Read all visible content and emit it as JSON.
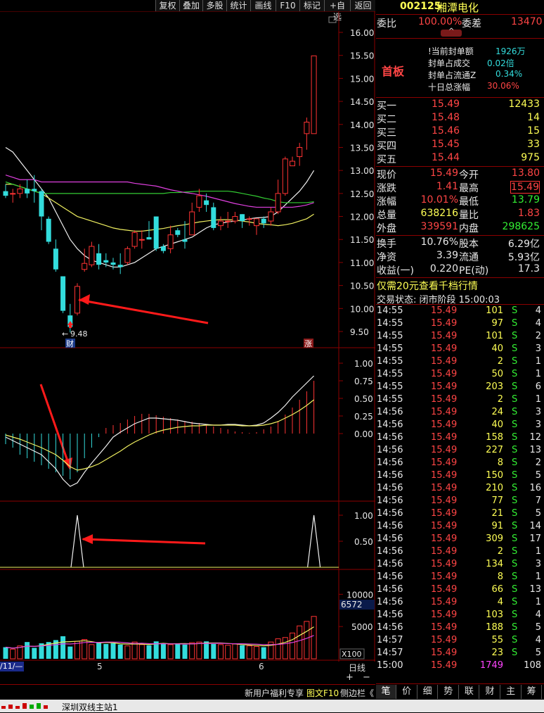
{
  "toolbar": {
    "buttons": [
      "复权",
      "叠加",
      "多股",
      "统计",
      "画线",
      "F10",
      "标记",
      "+自选",
      "返回"
    ],
    "stock_code": "002125",
    "stock_name": "湘潭电化"
  },
  "kline": {
    "y_ticks": [
      "16.00",
      "15.50",
      "15.00",
      "14.50",
      "14.00",
      "13.50",
      "13.00",
      "12.50",
      "12.00",
      "11.50",
      "11.00",
      "10.50",
      "10.00",
      "9.50"
    ],
    "low_label": "9.48",
    "badge_cai": "财",
    "badge_zhang": "涨"
  },
  "macd": {
    "y_ticks": [
      "1.00",
      "0.75",
      "0.50",
      "0.25",
      "0.00"
    ]
  },
  "ind2": {
    "y_ticks": [
      "1.00",
      "0.50"
    ]
  },
  "volume": {
    "y_ticks": [
      "10000",
      "5000"
    ],
    "current": "6572",
    "unit": "X100"
  },
  "dates": {
    "left": "/11/—",
    "mid1": "5",
    "mid2": "6",
    "period": "日线"
  },
  "chart_data": {
    "type": "candlestick",
    "ylim": [
      9.3,
      16.1
    ],
    "candles": [
      {
        "o": 12.55,
        "c": 12.45,
        "h": 12.7,
        "l": 12.4
      },
      {
        "o": 12.5,
        "c": 12.5,
        "h": 12.6,
        "l": 12.3
      },
      {
        "o": 12.5,
        "c": 12.6,
        "h": 12.7,
        "l": 12.4
      },
      {
        "o": 12.6,
        "c": 12.5,
        "h": 12.8,
        "l": 12.4
      },
      {
        "o": 12.6,
        "c": 12.55,
        "h": 12.9,
        "l": 12.3
      },
      {
        "o": 12.55,
        "c": 12.0,
        "h": 12.6,
        "l": 11.7
      },
      {
        "o": 11.95,
        "c": 11.45,
        "h": 12.0,
        "l": 11.4
      },
      {
        "o": 11.3,
        "c": 10.85,
        "h": 11.5,
        "l": 10.8
      },
      {
        "o": 10.7,
        "c": 9.95,
        "h": 10.7,
        "l": 9.9
      },
      {
        "o": 9.85,
        "c": 9.6,
        "h": 10.1,
        "l": 9.48
      },
      {
        "o": 9.9,
        "c": 10.48,
        "h": 10.55,
        "l": 9.85
      },
      {
        "o": 10.85,
        "c": 10.98,
        "h": 11.3,
        "l": 10.8
      },
      {
        "o": 10.95,
        "c": 11.35,
        "h": 11.45,
        "l": 10.9
      },
      {
        "o": 11.2,
        "c": 10.95,
        "h": 11.4,
        "l": 10.85
      },
      {
        "o": 11.05,
        "c": 11.0,
        "h": 11.2,
        "l": 10.9
      },
      {
        "o": 11.0,
        "c": 10.95,
        "h": 11.1,
        "l": 10.85
      },
      {
        "o": 10.95,
        "c": 10.9,
        "h": 11.2,
        "l": 10.75
      },
      {
        "o": 11.0,
        "c": 11.3,
        "h": 11.35,
        "l": 10.95
      },
      {
        "o": 11.35,
        "c": 11.65,
        "h": 11.7,
        "l": 11.3
      },
      {
        "o": 11.5,
        "c": 11.5,
        "h": 11.7,
        "l": 11.3
      },
      {
        "o": 11.55,
        "c": 11.5,
        "h": 11.9,
        "l": 11.5
      },
      {
        "o": 12.0,
        "c": 11.3,
        "h": 12.0,
        "l": 11.25
      },
      {
        "o": 11.35,
        "c": 11.25,
        "h": 11.4,
        "l": 11.2
      },
      {
        "o": 11.3,
        "c": 11.6,
        "h": 11.8,
        "l": 11.2
      },
      {
        "o": 11.7,
        "c": 11.6,
        "h": 11.75,
        "l": 11.55
      },
      {
        "o": 11.5,
        "c": 11.45,
        "h": 11.9,
        "l": 11.3
      },
      {
        "o": 11.6,
        "c": 12.1,
        "h": 12.3,
        "l": 11.6
      },
      {
        "o": 12.2,
        "c": 12.45,
        "h": 12.6,
        "l": 12.1
      },
      {
        "o": 12.35,
        "c": 12.25,
        "h": 12.5,
        "l": 12.1
      },
      {
        "o": 12.2,
        "c": 11.75,
        "h": 12.3,
        "l": 11.7
      },
      {
        "o": 11.8,
        "c": 11.9,
        "h": 12.0,
        "l": 11.7
      },
      {
        "o": 11.9,
        "c": 11.9,
        "h": 12.1,
        "l": 11.75
      },
      {
        "o": 11.9,
        "c": 12.0,
        "h": 12.1,
        "l": 11.85
      },
      {
        "o": 12.05,
        "c": 11.9,
        "h": 12.05,
        "l": 11.75
      },
      {
        "o": 11.95,
        "c": 11.95,
        "h": 12.0,
        "l": 11.8
      },
      {
        "o": 11.8,
        "c": 11.95,
        "h": 11.95,
        "l": 11.6
      },
      {
        "o": 11.95,
        "c": 11.85,
        "h": 12.0,
        "l": 11.75
      },
      {
        "o": 11.9,
        "c": 12.1,
        "h": 12.2,
        "l": 11.8
      },
      {
        "o": 12.1,
        "c": 12.5,
        "h": 12.8,
        "l": 12.05
      },
      {
        "o": 12.5,
        "c": 13.25,
        "h": 13.3,
        "l": 12.45
      },
      {
        "o": 13.1,
        "c": 13.2,
        "h": 13.3,
        "l": 13.1
      },
      {
        "o": 13.3,
        "c": 13.5,
        "h": 13.6,
        "l": 13.1
      },
      {
        "o": 13.8,
        "c": 14.05,
        "h": 14.15,
        "l": 13.45
      },
      {
        "o": 13.8,
        "c": 15.49,
        "h": 15.49,
        "l": 13.8
      }
    ],
    "ma_white": [
      13.5,
      13.4,
      13.2,
      13.0,
      12.8,
      12.6,
      12.4,
      12.1,
      11.8,
      11.5,
      11.3,
      11.15,
      11.05,
      11.0,
      10.95,
      10.9,
      10.9,
      10.95,
      11.0,
      11.1,
      11.2,
      11.3,
      11.35,
      11.4,
      11.45,
      11.5,
      11.55,
      11.65,
      11.75,
      11.82,
      11.85,
      11.88,
      11.9,
      11.92,
      11.95,
      11.97,
      11.98,
      12.0,
      12.1,
      12.25,
      12.4,
      12.55,
      12.75,
      13.0
    ],
    "ma_yellow": [
      12.7,
      12.7,
      12.65,
      12.6,
      12.55,
      12.5,
      12.4,
      12.3,
      12.2,
      12.1,
      12.0,
      11.95,
      11.9,
      11.85,
      11.8,
      11.75,
      11.72,
      11.7,
      11.68,
      11.68,
      11.7,
      11.72,
      11.74,
      11.77,
      11.8,
      11.82,
      11.85,
      11.88,
      11.9,
      11.92,
      11.93,
      11.93,
      11.92,
      11.9,
      11.88,
      11.85,
      11.83,
      11.82,
      11.8,
      11.82,
      11.85,
      11.9,
      11.95,
      12.05
    ],
    "ma_green": [
      12.75,
      12.7,
      12.65,
      12.6,
      12.55,
      12.5,
      12.5,
      12.5,
      12.5,
      12.5,
      12.5,
      12.5,
      12.5,
      12.5,
      12.5,
      12.5,
      12.5,
      12.5,
      12.5,
      12.5,
      12.5,
      12.5,
      12.5,
      12.52,
      12.52,
      12.53,
      12.54,
      12.55,
      12.55,
      12.55,
      12.55,
      12.55,
      12.53,
      12.5,
      12.47,
      12.44,
      12.4,
      12.37,
      12.32,
      12.3,
      12.3,
      12.3,
      12.3,
      12.32
    ],
    "ma_magenta": [
      12.9,
      12.85,
      12.8,
      12.8,
      12.8,
      12.75,
      12.75,
      12.75,
      12.75,
      12.75,
      12.75,
      12.75,
      12.75,
      12.75,
      12.75,
      12.75,
      12.75,
      12.75,
      12.72,
      12.7,
      12.68,
      12.66,
      12.62,
      12.58,
      12.55,
      12.52,
      12.5,
      12.47,
      12.44,
      12.4,
      12.36,
      12.32,
      12.28,
      12.25,
      12.22,
      12.2,
      12.2,
      12.2,
      12.2,
      12.2,
      12.2,
      12.22,
      12.25,
      12.3
    ],
    "macd_hist": [
      -0.15,
      -0.2,
      -0.3,
      -0.35,
      -0.4,
      -0.45,
      -0.5,
      -0.55,
      -0.6,
      -0.65,
      -0.55,
      -0.35,
      -0.2,
      -0.05,
      0.08,
      0.12,
      0.15,
      0.2,
      0.25,
      0.28,
      0.28,
      0.26,
      0.24,
      0.22,
      0.2,
      0.18,
      0.17,
      0.15,
      0.12,
      0.1,
      0.08,
      0.06,
      0.03,
      0.02,
      0.01,
      0.02,
      0.06,
      0.1,
      0.18,
      0.27,
      0.37,
      0.48,
      0.6,
      0.75
    ],
    "dif": [
      -0.05,
      -0.1,
      -0.15,
      -0.2,
      -0.25,
      -0.3,
      -0.4,
      -0.5,
      -0.65,
      -0.75,
      -0.7,
      -0.55,
      -0.42,
      -0.3,
      -0.18,
      -0.05,
      0.02,
      0.08,
      0.14,
      0.18,
      0.22,
      0.22,
      0.21,
      0.2,
      0.19,
      0.17,
      0.15,
      0.14,
      0.13,
      0.12,
      0.12,
      0.13,
      0.13,
      0.12,
      0.11,
      0.12,
      0.15,
      0.22,
      0.3,
      0.4,
      0.52,
      0.62,
      0.72,
      0.82
    ],
    "dea": [
      -0.02,
      -0.05,
      -0.08,
      -0.12,
      -0.16,
      -0.2,
      -0.25,
      -0.3,
      -0.38,
      -0.47,
      -0.52,
      -0.5,
      -0.47,
      -0.43,
      -0.37,
      -0.31,
      -0.25,
      -0.18,
      -0.12,
      -0.07,
      -0.02,
      0.02,
      0.05,
      0.07,
      0.09,
      0.1,
      0.11,
      0.11,
      0.12,
      0.12,
      0.12,
      0.12,
      0.12,
      0.11,
      0.11,
      0.11,
      0.12,
      0.14,
      0.17,
      0.22,
      0.27,
      0.33,
      0.4,
      0.48
    ],
    "signal": [
      0,
      0,
      0,
      0,
      0,
      0,
      0,
      0,
      0,
      0,
      1,
      0,
      0,
      0,
      0,
      0,
      0,
      0,
      0,
      0,
      0,
      0,
      0,
      0,
      0,
      0,
      0,
      0,
      0,
      0,
      0,
      0,
      0,
      0,
      0,
      0,
      0,
      0,
      0,
      0,
      0,
      0,
      0,
      1
    ],
    "volume": [
      1800,
      1500,
      2000,
      2600,
      1700,
      2400,
      2600,
      2900,
      3500,
      1900,
      2700,
      3000,
      2200,
      2500,
      2300,
      2400,
      2200,
      2000,
      2600,
      2200,
      2100,
      2700,
      2400,
      2200,
      2300,
      2200,
      2500,
      2600,
      2700,
      2300,
      2200,
      2100,
      2300,
      2100,
      2000,
      1900,
      1800,
      2600,
      3100,
      3300,
      4000,
      5100,
      5800,
      6572
    ],
    "vol_ylim": [
      0,
      12000
    ]
  },
  "right": {
    "weibi_label": "委比",
    "weibi_value": "100.00%",
    "weicha_label": "委差",
    "weicha_value": "13470",
    "first_board": "首板",
    "seal_rows": [
      {
        "label": "!当前封单额",
        "value": "1926万"
      },
      {
        "label": "封单占成交",
        "value": "0.02倍"
      },
      {
        "label": "封单占流通Z",
        "value": "0.34%"
      },
      {
        "label": "十日总涨幅",
        "value": "30.06%"
      }
    ],
    "bids": [
      {
        "label": "买一",
        "price": "15.49",
        "vol": "12433"
      },
      {
        "label": "买二",
        "price": "15.48",
        "vol": "14"
      },
      {
        "label": "买三",
        "price": "15.46",
        "vol": "15"
      },
      {
        "label": "买四",
        "price": "15.45",
        "vol": "33"
      },
      {
        "label": "买五",
        "price": "15.44",
        "vol": "975"
      }
    ],
    "quote": [
      {
        "l1": "现价",
        "v1": "15.49",
        "l2": "今开",
        "v2": "13.80"
      },
      {
        "l1": "涨跌",
        "v1": "1.41",
        "l2": "最高",
        "v2": "15.49"
      },
      {
        "l1": "涨幅",
        "v1": "10.01%",
        "l2": "最低",
        "v2": "13.79"
      },
      {
        "l1": "总量",
        "v1": "638216",
        "l2": "量比",
        "v2": "1.83"
      },
      {
        "l1": "外盘",
        "v1": "339591",
        "l2": "内盘",
        "v2": "298625"
      }
    ],
    "quote2": [
      {
        "l1": "换手",
        "v1": "10.76%",
        "l2": "股本",
        "v2": "6.29亿"
      },
      {
        "l1": "净资",
        "v1": "3.39",
        "l2": "流通",
        "v2": "5.93亿"
      },
      {
        "l1": "收益(一)",
        "v1": "0.220",
        "l2": "PE(动)",
        "v2": "17.3"
      }
    ],
    "promo": "仅需20元查看千档行情",
    "trade_status": "交易状态: 闭市阶段 15:00:03",
    "ticks": [
      {
        "t": "14:55",
        "p": "15.49",
        "v": "101",
        "s": "S",
        "n": "4"
      },
      {
        "t": "14:55",
        "p": "15.49",
        "v": "97",
        "s": "S",
        "n": "4"
      },
      {
        "t": "14:55",
        "p": "15.49",
        "v": "101",
        "s": "S",
        "n": "2"
      },
      {
        "t": "14:55",
        "p": "15.49",
        "v": "40",
        "s": "S",
        "n": "3"
      },
      {
        "t": "14:55",
        "p": "15.49",
        "v": "2",
        "s": "S",
        "n": "1"
      },
      {
        "t": "14:55",
        "p": "15.49",
        "v": "50",
        "s": "S",
        "n": "1"
      },
      {
        "t": "14:55",
        "p": "15.49",
        "v": "203",
        "s": "S",
        "n": "6"
      },
      {
        "t": "14:55",
        "p": "15.49",
        "v": "2",
        "s": "S",
        "n": "1"
      },
      {
        "t": "14:56",
        "p": "15.49",
        "v": "24",
        "s": "S",
        "n": "3"
      },
      {
        "t": "14:56",
        "p": "15.49",
        "v": "40",
        "s": "S",
        "n": "3"
      },
      {
        "t": "14:56",
        "p": "15.49",
        "v": "158",
        "s": "S",
        "n": "12"
      },
      {
        "t": "14:56",
        "p": "15.49",
        "v": "227",
        "s": "S",
        "n": "13"
      },
      {
        "t": "14:56",
        "p": "15.49",
        "v": "8",
        "s": "S",
        "n": "2"
      },
      {
        "t": "14:56",
        "p": "15.49",
        "v": "150",
        "s": "S",
        "n": "5"
      },
      {
        "t": "14:56",
        "p": "15.49",
        "v": "210",
        "s": "S",
        "n": "16"
      },
      {
        "t": "14:56",
        "p": "15.49",
        "v": "77",
        "s": "S",
        "n": "7"
      },
      {
        "t": "14:56",
        "p": "15.49",
        "v": "21",
        "s": "S",
        "n": "5"
      },
      {
        "t": "14:56",
        "p": "15.49",
        "v": "91",
        "s": "S",
        "n": "14"
      },
      {
        "t": "14:56",
        "p": "15.49",
        "v": "309",
        "s": "S",
        "n": "17"
      },
      {
        "t": "14:56",
        "p": "15.49",
        "v": "2",
        "s": "S",
        "n": "1"
      },
      {
        "t": "14:56",
        "p": "15.49",
        "v": "134",
        "s": "S",
        "n": "3"
      },
      {
        "t": "14:56",
        "p": "15.49",
        "v": "8",
        "s": "S",
        "n": "1"
      },
      {
        "t": "14:56",
        "p": "15.49",
        "v": "66",
        "s": "S",
        "n": "13"
      },
      {
        "t": "14:56",
        "p": "15.49",
        "v": "4",
        "s": "S",
        "n": "1"
      },
      {
        "t": "14:56",
        "p": "15.49",
        "v": "103",
        "s": "S",
        "n": "4"
      },
      {
        "t": "14:56",
        "p": "15.49",
        "v": "188",
        "s": "S",
        "n": "5"
      },
      {
        "t": "14:57",
        "p": "15.49",
        "v": "55",
        "s": "S",
        "n": "4"
      },
      {
        "t": "14:57",
        "p": "15.49",
        "v": "23",
        "s": "S",
        "n": "5"
      },
      {
        "t": "15:00",
        "p": "15.49",
        "v": "1749",
        "s": "",
        "n": "108"
      }
    ],
    "tabs": [
      "笔",
      "价",
      "细",
      "势",
      "联",
      "财",
      "主",
      "筹"
    ]
  },
  "bottom": {
    "promo_text": "新用户福利专享",
    "tuwen": "图文F10",
    "sidebar": "侧边栏《"
  },
  "status": {
    "server": "深圳双线主站1"
  },
  "colors": {
    "up": "#ff3333",
    "down": "#33dddd",
    "grid": "#8b0000"
  }
}
